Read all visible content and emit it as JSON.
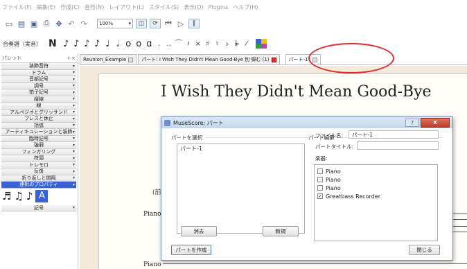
{
  "menu": [
    "ファイル(F)",
    "編集(E)",
    "作成(C)",
    "音符(N)",
    "レイアウト(L)",
    "スタイル(S)",
    "表示(D)",
    "Plugins",
    "ヘルプ(H)"
  ],
  "toolbar": {
    "zoom_value": "100%",
    "mode_label": "合奏譜（実音）",
    "note_mode": "N"
  },
  "palette": {
    "header": "パレット",
    "header_icons": "♯ ×",
    "items": [
      {
        "label": "装飾音符",
        "selected": false
      },
      {
        "label": "ドラム",
        "selected": false
      },
      {
        "label": "音部記号",
        "selected": false
      },
      {
        "label": "調号",
        "selected": false
      },
      {
        "label": "拍子記号",
        "selected": false
      },
      {
        "label": "縦線",
        "selected": false
      },
      {
        "label": "線",
        "selected": false
      },
      {
        "label": "アルペジオとグリッサンド",
        "selected": false
      },
      {
        "label": "ブレスと休止",
        "selected": false
      },
      {
        "label": "括弧",
        "selected": false
      },
      {
        "label": "アーティキュレーションと装飾",
        "selected": false
      },
      {
        "label": "臨時記号",
        "selected": false
      },
      {
        "label": "強弱",
        "selected": false
      },
      {
        "label": "フィンガリング",
        "selected": false
      },
      {
        "label": "符頭",
        "selected": false
      },
      {
        "label": "トレモロ",
        "selected": false
      },
      {
        "label": "反復",
        "selected": false
      },
      {
        "label": "折り返しと間隔",
        "selected": false
      },
      {
        "label": "連桁のプロパティ",
        "selected": true
      }
    ],
    "glyph_selected": "A",
    "bottom_item": "記号",
    "accent_color": "#3b63d6"
  },
  "tabs": [
    {
      "label": "Reunion_Example",
      "active": false,
      "close_red": false
    },
    {
      "label": "パート: I Wish They Didn't Mean Good-Bye 別 弾む (1)",
      "active": false,
      "close_red": true
    },
    {
      "label": "パート-1*",
      "active": true,
      "close_red": false
    }
  ],
  "score": {
    "title": "I Wish They Didn't Mean Good-Bye",
    "subtitle": "(前",
    "instrument_1": "Piano",
    "instrument_2": "Piano"
  },
  "dialog": {
    "title": "MuseScore: パート",
    "help": "?",
    "close": "x",
    "select_group": "パートを選択",
    "edit_group": "パート編集",
    "parts": [
      "パート-1"
    ],
    "delete_button": "消去",
    "new_button": "新規",
    "create_button": "パートを作成",
    "close_button": "閉じる",
    "filename_label": "ファイル名:",
    "filename_value": "パート-1",
    "part_title_label": "パートタイトル:",
    "part_title_value": "",
    "instruments_label": "楽器:",
    "instruments": [
      {
        "name": "Piano",
        "checked": false
      },
      {
        "name": "Piano",
        "checked": false
      },
      {
        "name": "Piano",
        "checked": false
      },
      {
        "name": "Greatbass Recorder",
        "checked": true
      }
    ]
  }
}
